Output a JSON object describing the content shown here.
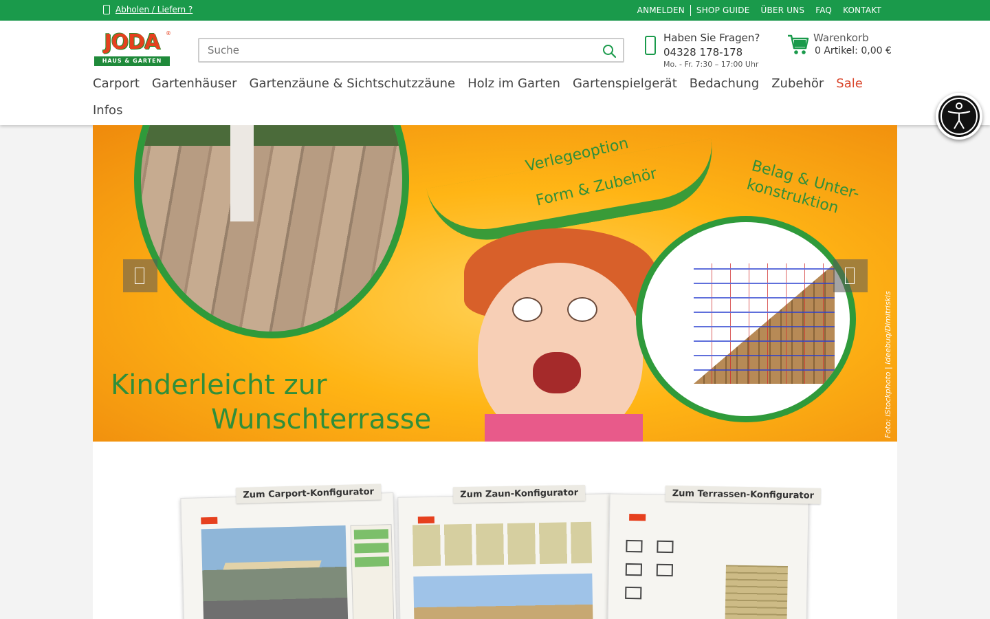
{
  "topbar": {
    "pickup_label": "Abholen / Liefern ?",
    "links": [
      "ANMELDEN",
      "SHOP GUIDE",
      "ÜBER UNS",
      "FAQ",
      "KONTAKT"
    ]
  },
  "logo": {
    "word": "JODA",
    "sub": "HAUS & GARTEN",
    "reg": "®"
  },
  "search": {
    "placeholder": "Suche"
  },
  "contact": {
    "title": "Haben Sie Fragen?",
    "phone": "04328 178-178",
    "hours": "Mo. - Fr. 7:30 – 17:00 Uhr"
  },
  "cart": {
    "title": "Warenkorb",
    "summary": "0 Artikel: 0,00 €"
  },
  "nav": {
    "items": [
      "Carport",
      "Gartenhäuser",
      "Gartenzäune & Sichtschutzzäune",
      "Holz im Garten",
      "Gartenspielgerät",
      "Bedachung",
      "Zubehör",
      "Sale"
    ],
    "row2": [
      "Infos"
    ]
  },
  "hero": {
    "checks": [
      "Verlegeoption",
      "Form & Zubehör",
      "Belag & Unter-konstruktion"
    ],
    "headline_1": "Kinderleicht zur",
    "headline_2": "Wunschterrasse",
    "credit": "Foto: iStockphoto | Ideebuq/Dimitriskis"
  },
  "configurators": [
    "Zum Carport-Konfigurator",
    "Zum Zaun-Konfigurator",
    "Zum Terrassen-Konfigurator"
  ],
  "colors": {
    "brand_green": "#1a9a4b",
    "sale_red": "#d9442a",
    "logo_red": "#e6401e"
  },
  "icons": [
    "map-pin-icon",
    "search-icon",
    "phone-icon",
    "cart-icon",
    "accessibility-icon",
    "chevron-left-icon",
    "chevron-right-icon"
  ]
}
